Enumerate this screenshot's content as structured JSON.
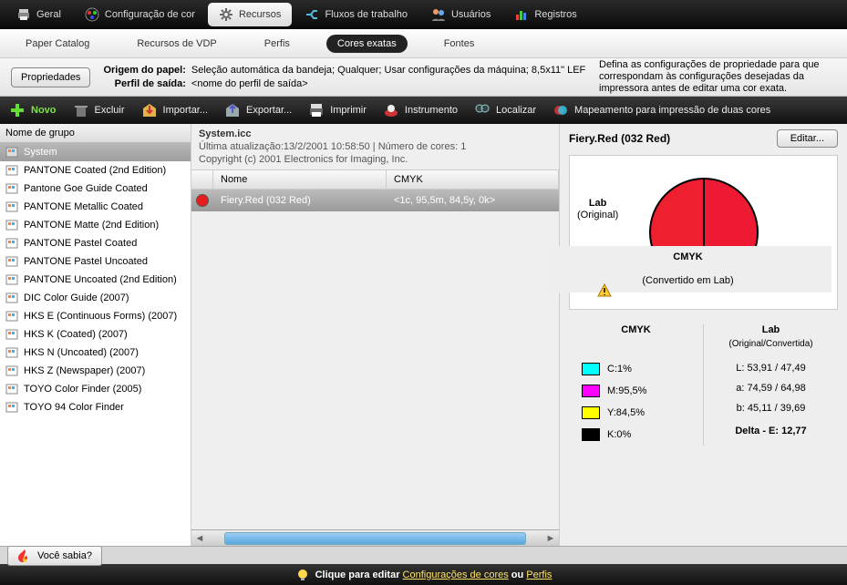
{
  "topTabs": [
    {
      "label": "Geral",
      "icon": "printer"
    },
    {
      "label": "Configuração de cor",
      "icon": "palette"
    },
    {
      "label": "Recursos",
      "icon": "gear",
      "active": true
    },
    {
      "label": "Fluxos de trabalho",
      "icon": "flow"
    },
    {
      "label": "Usuários",
      "icon": "users"
    },
    {
      "label": "Registros",
      "icon": "chart"
    }
  ],
  "subTabs": [
    "Paper Catalog",
    "Recursos de VDP",
    "Perfis",
    "Cores exatas",
    "Fontes"
  ],
  "subTabActive": "Cores exatas",
  "prop": {
    "button": "Propriedades",
    "origLabel": "Origem do papel:",
    "origValue": "Seleção automática da bandeja; Qualquer; Usar configurações da máquina; 8,5x11\" LEF",
    "outLabel": "Perfil de saída:",
    "outValue": "<nome do perfil de saída>",
    "desc": "Defina as configurações de propriedade para que correspondam às configurações desejadas da impressora antes de editar uma cor exata."
  },
  "toolbar": {
    "novo": "Novo",
    "excluir": "Excluir",
    "importar": "Importar...",
    "exportar": "Exportar...",
    "imprimir": "Imprimir",
    "instrumento": "Instrumento",
    "localizar": "Localizar",
    "mapeamento": "Mapeamento para impressão de duas cores"
  },
  "sidebarHeader": "Nome de grupo",
  "groups": [
    "System",
    "PANTONE Coated (2nd Edition)",
    "Pantone Goe Guide Coated",
    "PANTONE Metallic Coated",
    "PANTONE Matte (2nd Edition)",
    "PANTONE Pastel Coated",
    "PANTONE Pastel Uncoated",
    "PANTONE Uncoated (2nd Edition)",
    "DIC Color Guide (2007)",
    "HKS E (Continuous Forms) (2007)",
    "HKS K (Coated) (2007)",
    "HKS N (Uncoated) (2007)",
    "HKS Z (Newspaper) (2007)",
    "TOYO Color Finder (2005)",
    "TOYO 94 Color Finder"
  ],
  "center": {
    "title": "System.icc",
    "updated": "Última atualização:13/2/2001 10:58:50 | Número de cores: 1",
    "copyright": "Copyright (c) 2001 Electronics for Imaging, Inc.",
    "colName": "Nome",
    "colCmyk": "CMYK",
    "rowName": "Fiery.Red (032 Red)",
    "rowCmyk": "<1c, 95,5m, 84,5y, 0k>"
  },
  "right": {
    "title": "Fiery.Red (032 Red)",
    "edit": "Editar...",
    "labLabel": "Lab",
    "labSub": "(Original)",
    "cmykLabel": "CMYK",
    "cmykSub": "(Convertido em Lab)",
    "cmykTitle": "CMYK",
    "labTitle": "Lab",
    "labTitleSub": "(Original/Convertida)",
    "c": "C:1%",
    "m": "M:95,5%",
    "y": "Y:84,5%",
    "k": "K:0%",
    "L": "L: 53,91 / 47,49",
    "a": "a: 74,59 / 64,98",
    "b": "b: 45,11 / 39,69",
    "delta": "Delta - E:   12,77"
  },
  "footer": {
    "didyouknow": "Você sabia?"
  },
  "tip": {
    "t1": "Clique para editar ",
    "l1": "Configurações de cores",
    "t2": " ou ",
    "l2": "Perfis"
  }
}
